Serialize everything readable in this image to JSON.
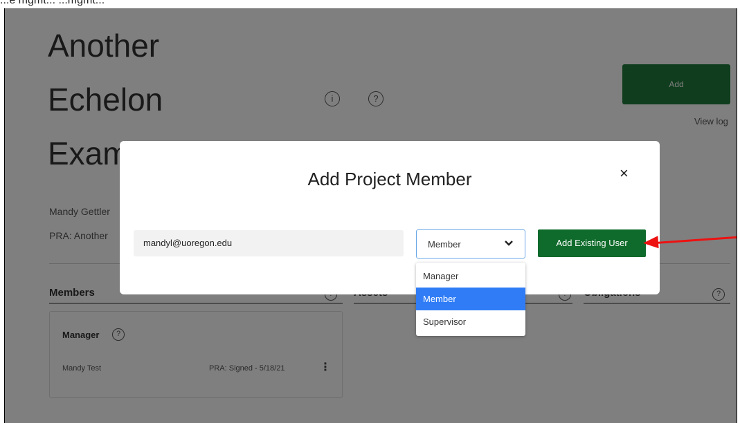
{
  "caption": "...e mgmt... ...mgmt...",
  "header": {
    "title_lines": [
      "Another",
      "Echelon",
      "Exam"
    ],
    "info_icon": "info-icon",
    "help_icon": "help-icon",
    "add_label": "Add",
    "view_log": "View log"
  },
  "meta": {
    "manager": "Mandy Gettler",
    "pra": "PRA: Another"
  },
  "sections": {
    "members": "Members",
    "assets": "Assets",
    "obligations": "Obligations"
  },
  "members_card": {
    "role": "Manager",
    "member_name": "Mandy Test",
    "status": "PRA: Signed - 5/18/21"
  },
  "modal": {
    "title": "Add Project Member",
    "close": "×",
    "email_value": "mandyl@uoregon.edu",
    "role_value": "Member",
    "role_options": [
      "Manager",
      "Member",
      "Supervisor"
    ],
    "selected_option": "Member",
    "add_button": "Add Existing User"
  },
  "colors": {
    "primary_green": "#0f6b2b",
    "select_highlight": "#2f7cf6",
    "annotation_arrow": "#e11111"
  }
}
